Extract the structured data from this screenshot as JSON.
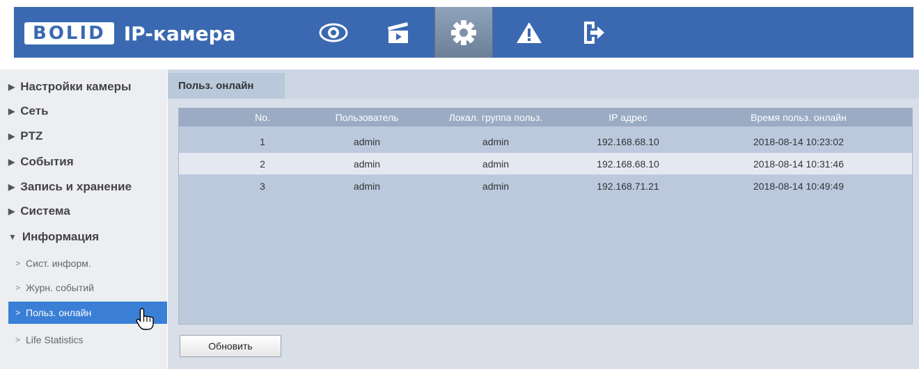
{
  "header": {
    "logo": "BOLID",
    "title": "IP-камера",
    "nav": [
      {
        "icon": "eye-icon"
      },
      {
        "icon": "clapperboard-icon"
      },
      {
        "icon": "gear-icon",
        "active": true
      },
      {
        "icon": "warning-icon"
      },
      {
        "icon": "logout-icon"
      }
    ]
  },
  "sidebar": {
    "menu": [
      {
        "label": "Настройки камеры",
        "arrow": "▶"
      },
      {
        "label": "Сеть",
        "arrow": "▶"
      },
      {
        "label": "PTZ",
        "arrow": "▶"
      },
      {
        "label": "События",
        "arrow": "▶"
      },
      {
        "label": "Запись и хранение",
        "arrow": "▶"
      },
      {
        "label": "Система",
        "arrow": "▶"
      },
      {
        "label": "Информация",
        "arrow": "▼"
      }
    ],
    "submenu": [
      {
        "label": "Сист. информ."
      },
      {
        "label": "Журн. событий"
      },
      {
        "label": "Польз. онлайн",
        "active": true
      },
      {
        "label": "Life Statistics"
      }
    ]
  },
  "content": {
    "tab": "Польз. онлайн",
    "table": {
      "headers": [
        "No.",
        "Пользователь",
        "Локал. группа польз.",
        "IP адрес",
        "Время польз. онлайн"
      ],
      "rows": [
        [
          "1",
          "admin",
          "admin",
          "192.168.68.10",
          "2018-08-14 10:23:02"
        ],
        [
          "2",
          "admin",
          "admin",
          "192.168.68.10",
          "2018-08-14 10:31:46"
        ],
        [
          "3",
          "admin",
          "admin",
          "192.168.71.21",
          "2018-08-14 10:49:49"
        ]
      ]
    },
    "refresh_label": "Обновить"
  },
  "colors": {
    "header": "#3a69b1",
    "active_menu": "#3a7fd5",
    "panel": "#bcc9dd",
    "table_header": "#9aabc3"
  }
}
